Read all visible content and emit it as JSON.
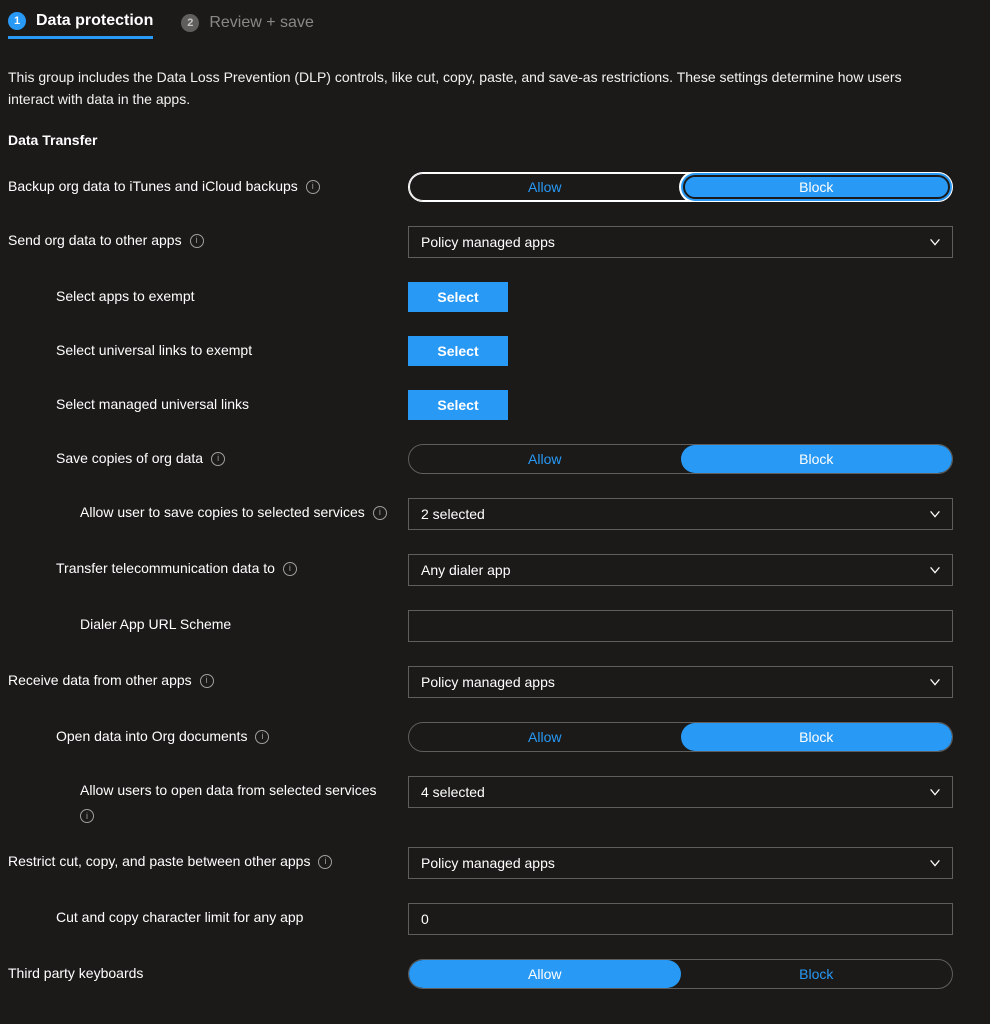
{
  "tabs": [
    {
      "num": "1",
      "label": "Data protection"
    },
    {
      "num": "2",
      "label": "Review + save"
    }
  ],
  "description": "This group includes the Data Loss Prevention (DLP) controls, like cut, copy, paste, and save-as restrictions. These settings determine how users interact with data in the apps.",
  "section": "Data Transfer",
  "settings": {
    "backup": {
      "label": "Backup org data to iTunes and iCloud backups",
      "options": [
        "Allow",
        "Block"
      ],
      "value": "Block"
    },
    "send_other_apps": {
      "label": "Send org data to other apps",
      "value": "Policy managed apps"
    },
    "apps_exempt": {
      "label": "Select apps to exempt",
      "button": "Select"
    },
    "ulinks_exempt": {
      "label": "Select universal links to exempt",
      "button": "Select"
    },
    "managed_ulinks": {
      "label": "Select managed universal links",
      "button": "Select"
    },
    "save_copies": {
      "label": "Save copies of org data",
      "options": [
        "Allow",
        "Block"
      ],
      "value": "Block"
    },
    "save_services": {
      "label": "Allow user to save copies to selected services",
      "value": "2 selected"
    },
    "telecom": {
      "label": "Transfer telecommunication data to",
      "value": "Any dialer app"
    },
    "dialer_scheme": {
      "label": "Dialer App URL Scheme",
      "value": ""
    },
    "receive_other": {
      "label": "Receive data from other apps",
      "value": "Policy managed apps"
    },
    "open_org": {
      "label": "Open data into Org documents",
      "options": [
        "Allow",
        "Block"
      ],
      "value": "Block"
    },
    "open_services": {
      "label": "Allow users to open data from selected services",
      "value": "4 selected"
    },
    "restrict_ccp": {
      "label": "Restrict cut, copy, and paste between other apps",
      "value": "Policy managed apps"
    },
    "char_limit": {
      "label": "Cut and copy character limit for any app",
      "value": "0"
    },
    "third_party_kb": {
      "label": "Third party keyboards",
      "options": [
        "Allow",
        "Block"
      ],
      "value": "Allow"
    }
  }
}
